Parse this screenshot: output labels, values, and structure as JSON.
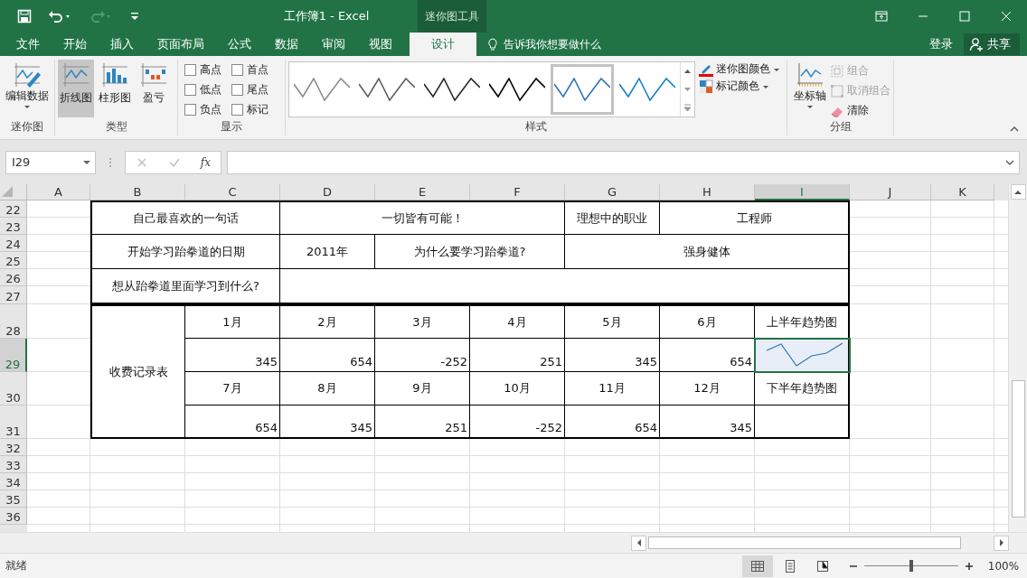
{
  "title_bar": {
    "title": "工作簿1 - Excel",
    "context_tab": "迷你图工具",
    "undo_enabled": true,
    "redo_enabled": false
  },
  "menu_tabs": [
    {
      "label": "文件",
      "selected": false
    },
    {
      "label": "开始",
      "selected": false
    },
    {
      "label": "插入",
      "selected": false
    },
    {
      "label": "页面布局",
      "selected": false
    },
    {
      "label": "公式",
      "selected": false
    },
    {
      "label": "数据",
      "selected": false
    },
    {
      "label": "审阅",
      "selected": false
    },
    {
      "label": "视图",
      "selected": false
    },
    {
      "label": "设计",
      "selected": true
    }
  ],
  "tell_me": "告诉我你想要做什么",
  "sign_in": "登录",
  "share": "共享",
  "ribbon": {
    "groups": [
      {
        "label": "迷你图",
        "kind": "sparkline",
        "buttons": [
          {
            "label": "编辑数据"
          }
        ]
      },
      {
        "label": "类型",
        "kind": "type",
        "buttons": [
          {
            "label": "折线图",
            "selected": true
          },
          {
            "label": "柱形图",
            "selected": false
          },
          {
            "label": "盈亏",
            "selected": false
          }
        ]
      },
      {
        "label": "显示",
        "kind": "show",
        "checkboxes": [
          {
            "label": "高点",
            "checked": false
          },
          {
            "label": "首点",
            "checked": false
          },
          {
            "label": "低点",
            "checked": false
          },
          {
            "label": "尾点",
            "checked": false
          },
          {
            "label": "负点",
            "checked": false
          },
          {
            "label": "标记",
            "checked": false
          }
        ]
      },
      {
        "label": "样式",
        "kind": "style",
        "styles": [
          {
            "color": "#8c8c8c",
            "selected": false
          },
          {
            "color": "#5f5f5f",
            "selected": false
          },
          {
            "color": "#2b2b2b",
            "selected": false
          },
          {
            "color": "#000000",
            "selected": false
          },
          {
            "color": "#2e75b6",
            "selected": true
          },
          {
            "color": "#1a80c8",
            "selected": false
          }
        ],
        "color_buttons": [
          {
            "label": "迷你图颜色"
          },
          {
            "label": "标记颜色"
          }
        ]
      },
      {
        "label": "分组",
        "kind": "group",
        "axis": "坐标轴",
        "actions": [
          {
            "label": "组合",
            "disabled": true
          },
          {
            "label": "取消组合",
            "disabled": true
          },
          {
            "label": "清除",
            "disabled": false
          }
        ]
      }
    ]
  },
  "formula_bar": {
    "name_box": "I29",
    "function_label": "fx"
  },
  "sheet": {
    "columns": [
      {
        "label": "A",
        "selected": false
      },
      {
        "label": "B",
        "selected": false
      },
      {
        "label": "C",
        "selected": false
      },
      {
        "label": "D",
        "selected": false
      },
      {
        "label": "E",
        "selected": false
      },
      {
        "label": "F",
        "selected": false
      },
      {
        "label": "G",
        "selected": false
      },
      {
        "label": "H",
        "selected": false
      },
      {
        "label": "I",
        "selected": true
      },
      {
        "label": "J",
        "selected": false
      },
      {
        "label": "K",
        "selected": false
      }
    ],
    "rows": [
      {
        "label": "22",
        "selected": false
      },
      {
        "label": "23",
        "selected": false
      },
      {
        "label": "24",
        "selected": false
      },
      {
        "label": "25",
        "selected": false
      },
      {
        "label": "26",
        "selected": false
      },
      {
        "label": "27",
        "selected": false
      },
      {
        "label": "28",
        "selected": false
      },
      {
        "label": "29",
        "selected": true
      },
      {
        "label": "30",
        "selected": false
      },
      {
        "label": "31",
        "selected": false
      },
      {
        "label": "32",
        "selected": false
      },
      {
        "label": "33",
        "selected": false
      },
      {
        "label": "34",
        "selected": false
      },
      {
        "label": "35",
        "selected": false
      },
      {
        "label": "36",
        "selected": false
      }
    ],
    "info_table": [
      "自己最喜欢的一句话",
      "一切皆有可能！",
      "理想中的职业",
      "工程师",
      "开始学习跆拳道的日期",
      "2011年",
      "为什么要学习跆拳道?",
      "强身健体",
      "想从跆拳道里面学习到什么?"
    ],
    "fee_table": {
      "title": "收费记录表",
      "halves": [
        {
          "months": [
            "1月",
            "2月",
            "3月",
            "4月",
            "5月",
            "6月"
          ],
          "values": [
            "345",
            "654",
            "-252",
            "251",
            "345",
            "654"
          ],
          "trend_label": "上半年趋势图",
          "sparkline": true,
          "selected": true
        },
        {
          "months": [
            "7月",
            "8月",
            "9月",
            "10月",
            "11月",
            "12月"
          ],
          "values": [
            "654",
            "345",
            "251",
            "-252",
            "654",
            "345"
          ],
          "trend_label": "下半年趋势图",
          "sparkline": false,
          "selected": false
        }
      ]
    }
  },
  "status_bar": {
    "ready": "就绪",
    "views": [
      {
        "selected": true
      },
      {
        "selected": false
      },
      {
        "selected": false
      }
    ],
    "zoom": "100%",
    "zoom_slider": {
      "level": 0.5
    }
  }
}
